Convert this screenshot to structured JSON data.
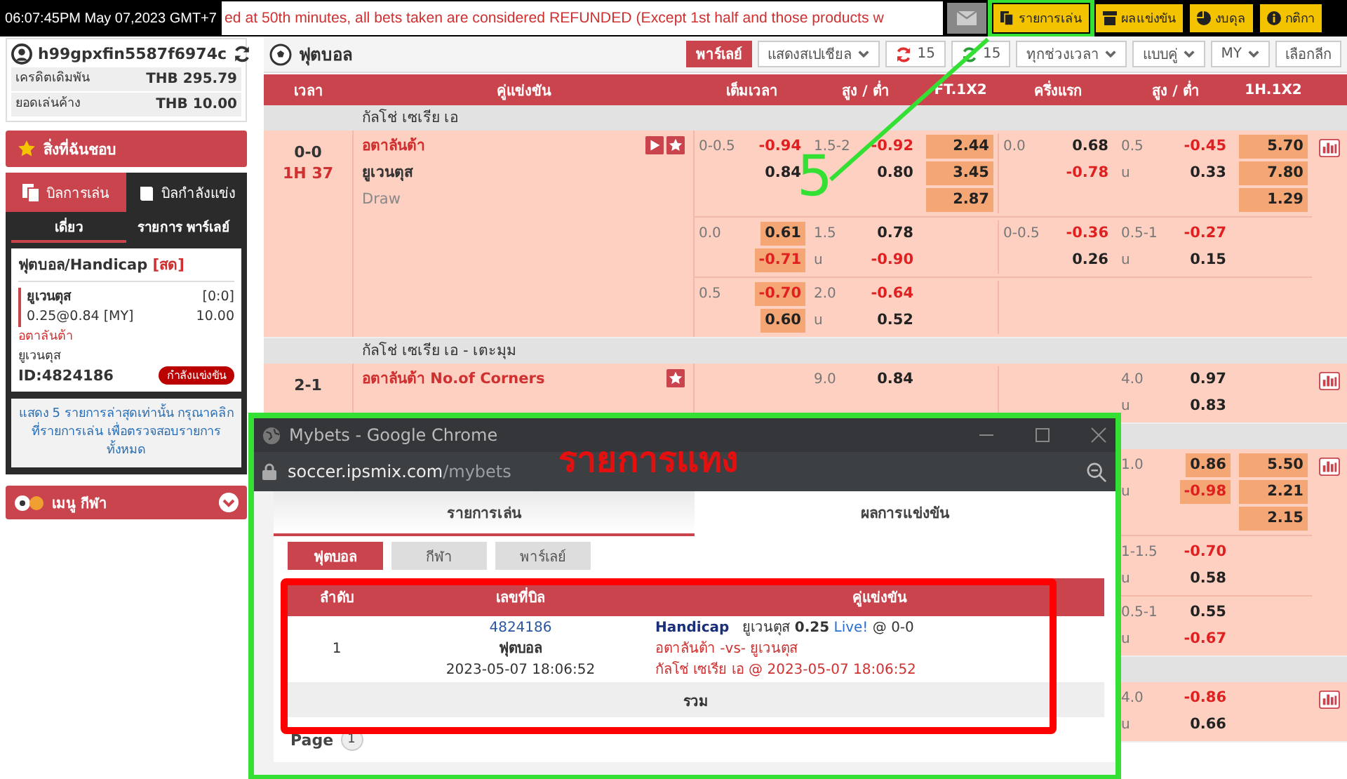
{
  "top_bar": {
    "clock": "06:07:45PM May 07,2023 GMT+7",
    "ticker": "ed at 50th minutes, all bets taken are considered REFUNDED (Except 1st half and those products w",
    "buttons": [
      {
        "label": "รายการเล่น"
      },
      {
        "label": "ผลแข่งขัน"
      },
      {
        "label": "งบดุล"
      },
      {
        "label": "กติกา"
      }
    ]
  },
  "sidebar": {
    "account": {
      "username": "h99gpxfin5587f6974c",
      "rows": [
        {
          "label": "เครดิตเดิมพัน",
          "value": "THB 295.79"
        },
        {
          "label": "ยอดเล่นค้าง",
          "value": "THB 10.00"
        }
      ]
    },
    "favorites": "สิ่งที่ฉันชอบ",
    "bill_tabs": [
      {
        "label": "บิลการเล่น",
        "selected": true
      },
      {
        "label": "บิลกำลังแข่ง",
        "selected": false
      }
    ],
    "slip_tabs": [
      {
        "label": "เดี่ยว",
        "selected": true
      },
      {
        "label": "รายการ พาร์เลย์",
        "selected": false
      }
    ],
    "bet": {
      "title": "ฟุตบอล/Handicap",
      "live_tag": "[สด]",
      "pick": "ยูเวนตุส",
      "score": "[0:0]",
      "odds": "0.25@0.84 [MY]",
      "stake": "10.00",
      "home": "อตาลันต้า",
      "away": "ยูเวนตุส",
      "id": "ID:4824186",
      "status": "กำลังแข่งขัน"
    },
    "note": "แสดง 5 รายการล่าสุดเท่านั้น กรุณาคลิกที่รายการเล่น เพื่อตรวจสอบรายการทั้งหมด",
    "sports_menu": "เมนู กีฬา"
  },
  "main": {
    "sport": "ฟุตบอล",
    "toolbar": [
      {
        "kind": "button",
        "label": "พาร์เลย์"
      },
      {
        "kind": "dropdown",
        "label": "แสดงสเปเชียล"
      },
      {
        "kind": "refresh",
        "label": "15",
        "color": "#e03030"
      },
      {
        "kind": "refresh",
        "label": "15",
        "color": "#2a9a3a"
      },
      {
        "kind": "dropdown",
        "label": "ทุกช่วงเวลา"
      },
      {
        "kind": "dropdown",
        "label": "แบบคู่"
      },
      {
        "kind": "dropdown",
        "label": "MY"
      },
      {
        "kind": "plain",
        "label": "เลือกลีก"
      }
    ],
    "columns": [
      "เวลา",
      "คู่แข่งขัน",
      "เต็มเวลา",
      "สูง / ต่ำ",
      "FT.1X2",
      "ครึ่งแรก",
      "สูง / ต่ำ",
      "1H.1X2"
    ],
    "rows": [
      {
        "kind": "league",
        "name": "กัลโช่ เซเรีย เอ"
      },
      {
        "kind": "match",
        "score": "0-0",
        "clock": "1H 37",
        "teams": [
          {
            "name": "อตาลันต้า",
            "kind": "home"
          },
          {
            "name": "ยูเวนตุส",
            "kind": "away"
          },
          {
            "name": "Draw",
            "kind": "draw"
          }
        ],
        "live": true,
        "favorite": true,
        "stats": true,
        "lines": [
          {
            "ft_hdp": {
              "lines": [
                "0-0.5"
              ],
              "odds": [
                {
                  "value": "-0.94",
                  "negative": true,
                  "highlighted": false
                },
                {
                  "value": "0.84",
                  "negative": false,
                  "highlighted": false
                }
              ]
            },
            "ft_ou": {
              "lines": [
                "1.5-2"
              ],
              "odds": [
                {
                  "value": "-0.92",
                  "negative": true,
                  "highlighted": false
                },
                {
                  "value": "0.80",
                  "negative": false,
                  "highlighted": false
                }
              ]
            },
            "ft_1x2": {
              "odds": [
                {
                  "value": "2.44",
                  "negative": false,
                  "highlighted": true
                },
                {
                  "value": "3.45",
                  "negative": false,
                  "highlighted": true
                },
                {
                  "value": "2.87",
                  "negative": false,
                  "highlighted": true
                }
              ]
            },
            "h1_hdp": {
              "lines": [
                "0.0"
              ],
              "odds": [
                {
                  "value": "0.68",
                  "negative": false,
                  "highlighted": false
                },
                {
                  "value": "-0.78",
                  "negative": true,
                  "highlighted": false
                }
              ]
            },
            "h1_ou": {
              "lines": [
                "0.5",
                "u"
              ],
              "odds": [
                {
                  "value": "-0.45",
                  "negative": true,
                  "highlighted": false
                },
                {
                  "value": "0.33",
                  "negative": false,
                  "highlighted": false
                }
              ]
            },
            "h1_1x2": {
              "odds": [
                {
                  "value": "5.70",
                  "negative": false,
                  "highlighted": true
                },
                {
                  "value": "7.80",
                  "negative": false,
                  "highlighted": true
                },
                {
                  "value": "1.29",
                  "negative": false,
                  "highlighted": true
                }
              ]
            }
          },
          {
            "ft_hdp": {
              "lines": [
                "0.0"
              ],
              "odds": [
                {
                  "value": "0.61",
                  "negative": false,
                  "highlighted": true
                },
                {
                  "value": "-0.71",
                  "negative": true,
                  "highlighted": true
                }
              ]
            },
            "ft_ou": {
              "lines": [
                "1.5",
                "u"
              ],
              "odds": [
                {
                  "value": "0.78",
                  "negative": false,
                  "highlighted": false
                },
                {
                  "value": "-0.90",
                  "negative": true,
                  "highlighted": false
                }
              ]
            },
            "h1_hdp": {
              "lines": [
                "0-0.5"
              ],
              "odds": [
                {
                  "value": "-0.36",
                  "negative": true,
                  "highlighted": false
                },
                {
                  "value": "0.26",
                  "negative": false,
                  "highlighted": false
                }
              ]
            },
            "h1_ou": {
              "lines": [
                "0.5-1",
                "u"
              ],
              "odds": [
                {
                  "value": "-0.27",
                  "negative": true,
                  "highlighted": false
                },
                {
                  "value": "0.15",
                  "negative": false,
                  "highlighted": false
                }
              ]
            }
          },
          {
            "ft_hdp": {
              "lines": [
                "0.5"
              ],
              "odds": [
                {
                  "value": "-0.70",
                  "negative": true,
                  "highlighted": true
                },
                {
                  "value": "0.60",
                  "negative": false,
                  "highlighted": true
                }
              ]
            },
            "ft_ou": {
              "lines": [
                "2.0",
                "u"
              ],
              "odds": [
                {
                  "value": "-0.64",
                  "negative": true,
                  "highlighted": false
                },
                {
                  "value": "0.52",
                  "negative": false,
                  "highlighted": false
                }
              ]
            }
          }
        ]
      },
      {
        "kind": "league",
        "name": "กัลโช่ เซเรีย เอ - เตะมุม"
      },
      {
        "kind": "match",
        "score": "2-1",
        "teams": [
          {
            "name": "อตาลันต้า No.of Corners",
            "kind": "home"
          }
        ],
        "live": false,
        "favorite": true,
        "stats": true,
        "lines": [
          {
            "ft_ou": {
              "lines": [
                "9.0"
              ],
              "odds": [
                {
                  "value": "0.84",
                  "negative": false,
                  "highlighted": false
                }
              ]
            },
            "h1_ou": {
              "lines": [
                "4.0",
                "u"
              ],
              "odds": [
                {
                  "value": "0.97",
                  "negative": false,
                  "highlighted": false
                },
                {
                  "value": "0.83",
                  "negative": false,
                  "highlighted": false
                }
              ]
            }
          }
        ]
      },
      {
        "kind": "league"
      },
      {
        "kind": "match",
        "live": false,
        "favorite": false,
        "stats": true,
        "lines": [
          {
            "h1_ou": {
              "lines": [
                "1.0",
                "u"
              ],
              "odds": [
                {
                  "value": "0.86",
                  "negative": false,
                  "highlighted": true
                },
                {
                  "value": "-0.98",
                  "negative": true,
                  "highlighted": true
                }
              ]
            },
            "h1_1x2": {
              "odds": [
                {
                  "value": "5.50",
                  "negative": false,
                  "highlighted": true
                },
                {
                  "value": "2.21",
                  "negative": false,
                  "highlighted": true
                },
                {
                  "value": "2.15",
                  "negative": false,
                  "highlighted": true
                }
              ]
            }
          },
          {
            "h1_ou": {
              "lines": [
                "1-1.5",
                "u"
              ],
              "odds": [
                {
                  "value": "-0.70",
                  "negative": true,
                  "highlighted": false
                },
                {
                  "value": "0.58",
                  "negative": false,
                  "highlighted": false
                }
              ]
            }
          },
          {
            "h1_ou": {
              "lines": [
                "0.5-1",
                "u"
              ],
              "odds": [
                {
                  "value": "0.55",
                  "negative": false,
                  "highlighted": false
                },
                {
                  "value": "-0.67",
                  "negative": true,
                  "highlighted": false
                }
              ]
            }
          }
        ]
      },
      {
        "kind": "league"
      },
      {
        "kind": "match",
        "live": false,
        "favorite": false,
        "stats": true,
        "lines": [
          {
            "h1_ou": {
              "lines": [
                "4.0",
                "u"
              ],
              "odds": [
                {
                  "value": "-0.86",
                  "negative": true,
                  "highlighted": false
                },
                {
                  "value": "0.66",
                  "negative": false,
                  "highlighted": false
                }
              ]
            }
          }
        ]
      }
    ]
  },
  "popup": {
    "title": "Mybets - Google Chrome",
    "url_host": "soccer.ipsmix.com",
    "url_path": "/mybets",
    "tabs": [
      {
        "label": "รายการเล่น",
        "selected": true
      },
      {
        "label": "ผลการแข่งขัน",
        "selected": false
      }
    ],
    "sport_tabs": [
      {
        "label": "ฟุตบอล",
        "selected": true
      },
      {
        "label": "กีฬา",
        "selected": false
      },
      {
        "label": "พาร์เลย์",
        "selected": false
      }
    ],
    "columns": [
      "ลำดับ",
      "เลขที่บิล",
      "คู่แข่งขัน"
    ],
    "bets": [
      {
        "index": "1",
        "bill_no": "4824186",
        "sport": "ฟุตบอล",
        "placed": "2023-05-07 18:06:52",
        "market": "Handicap",
        "selection": "ยูเวนตุส **0.25**",
        "live": "Live!",
        "at_score": "@ 0-0",
        "fixture": "อตาลันต้า -vs- ยูเวนตุส",
        "league_time": "กัลโช่ เซเรีย เอ @ 2023-05-07 18:06:52"
      }
    ],
    "total_label": "รวม",
    "page_label": "Page",
    "pages": [
      {
        "label": "1",
        "selected": true
      }
    ]
  },
  "annotations": {
    "step": "5",
    "caption": "รายการแทง"
  }
}
